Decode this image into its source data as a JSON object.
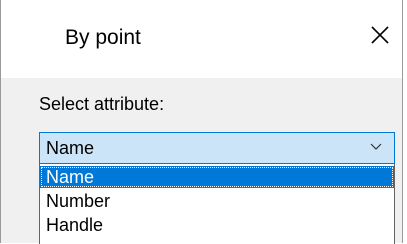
{
  "dialog": {
    "title": "By point",
    "close_icon": "close-icon"
  },
  "attribute": {
    "label": "Select attribute:",
    "selected_value": "Name",
    "chevron_icon": "chevron-down-icon",
    "options": [
      {
        "label": "Name",
        "selected": true
      },
      {
        "label": "Number",
        "selected": false
      },
      {
        "label": "Handle",
        "selected": false
      }
    ]
  },
  "colors": {
    "accent": "#0078d7",
    "select_bg": "#cce4f7",
    "body_bg": "#f0f0f0"
  }
}
